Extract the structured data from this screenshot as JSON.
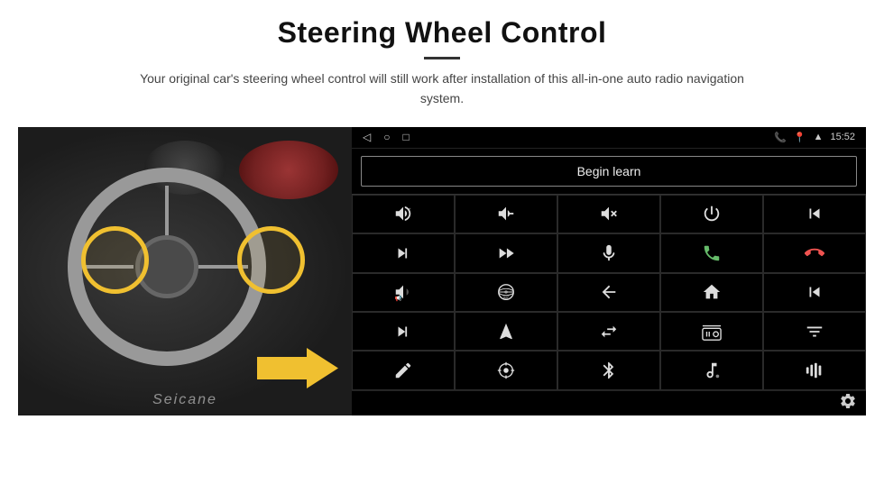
{
  "header": {
    "title": "Steering Wheel Control",
    "subtitle": "Your original car's steering wheel control will still work after installation of this all-in-one auto radio navigation system."
  },
  "android_ui": {
    "status_bar": {
      "time": "15:52",
      "nav_icons": [
        "◁",
        "○",
        "□"
      ]
    },
    "begin_learn_label": "Begin learn",
    "control_buttons": [
      {
        "icon": "vol_up",
        "symbol": "🔊+"
      },
      {
        "icon": "vol_down",
        "symbol": "🔊-"
      },
      {
        "icon": "vol_mute",
        "symbol": "🔇"
      },
      {
        "icon": "power",
        "symbol": "⏻"
      },
      {
        "icon": "prev_track",
        "symbol": "⏮"
      },
      {
        "icon": "next_track",
        "symbol": "⏭"
      },
      {
        "icon": "ff",
        "symbol": "⏩"
      },
      {
        "icon": "mic",
        "symbol": "🎤"
      },
      {
        "icon": "phone",
        "symbol": "📞"
      },
      {
        "icon": "hang_up",
        "symbol": "📵"
      },
      {
        "icon": "horn",
        "symbol": "📢"
      },
      {
        "icon": "360",
        "symbol": "360°"
      },
      {
        "icon": "back",
        "symbol": "↩"
      },
      {
        "icon": "home",
        "symbol": "⌂"
      },
      {
        "icon": "skip_back",
        "symbol": "⏮"
      },
      {
        "icon": "skip_fwd",
        "symbol": "⏭"
      },
      {
        "icon": "navigate",
        "symbol": "➤"
      },
      {
        "icon": "settings2",
        "symbol": "⇌"
      },
      {
        "icon": "radio",
        "symbol": "📻"
      },
      {
        "icon": "eq",
        "symbol": "🎚"
      },
      {
        "icon": "edit",
        "symbol": "✏"
      },
      {
        "icon": "circle_dot",
        "symbol": "⊙"
      },
      {
        "icon": "bluetooth",
        "symbol": "⚡"
      },
      {
        "icon": "music",
        "symbol": "🎵"
      },
      {
        "icon": "waveform",
        "symbol": "📶"
      }
    ]
  },
  "watermark": "Seicane"
}
